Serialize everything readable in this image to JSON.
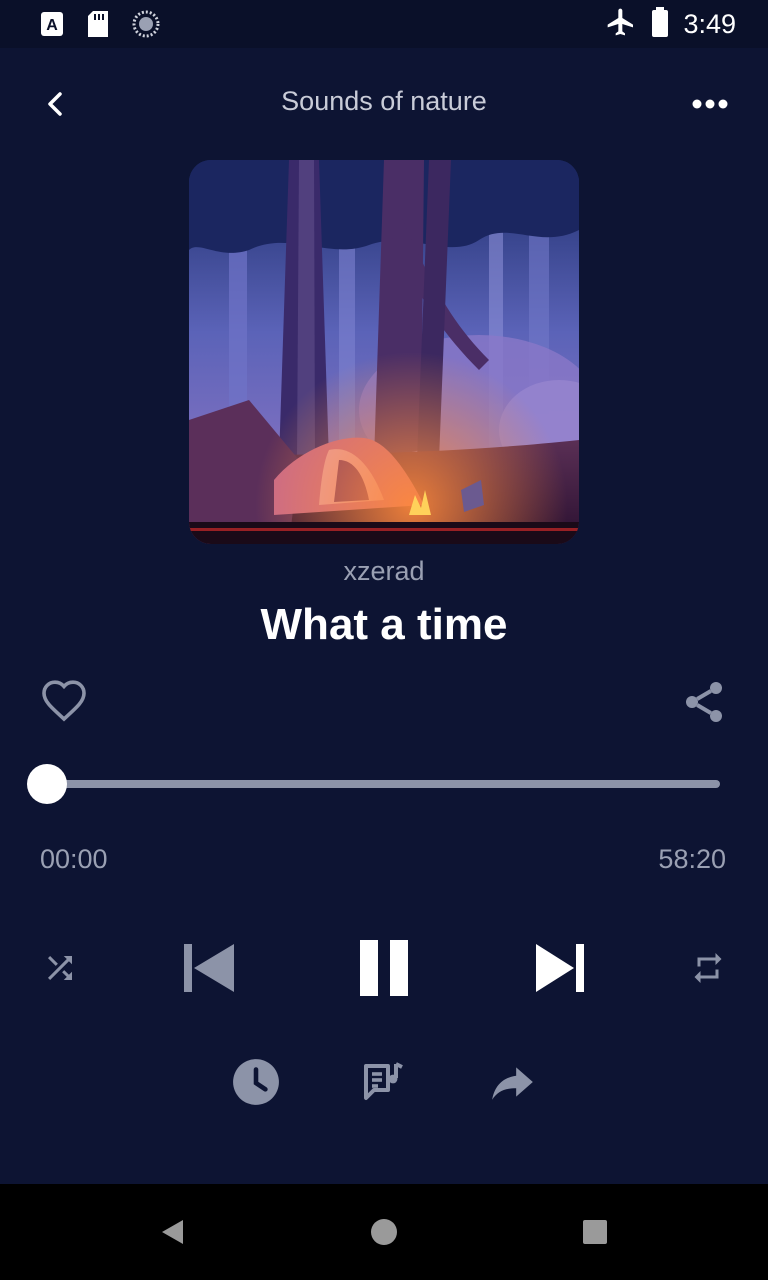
{
  "status_bar": {
    "time": "3:49",
    "icons": [
      "a-badge-icon",
      "sd-card-icon",
      "loading-spinner-icon",
      "airplane-icon",
      "battery-icon"
    ]
  },
  "header": {
    "title": "Sounds of nature",
    "back_icon": "chevron-left-icon",
    "menu_icon": "more-horizontal-icon"
  },
  "track": {
    "artist": "xzerad",
    "title": "What a time",
    "artwork": "camping-tent-forest-night-illustration"
  },
  "actions": {
    "favorite_icon": "heart-outline-icon",
    "share_icon": "share-icon"
  },
  "playback": {
    "elapsed": "00:00",
    "total": "58:20",
    "progress_fraction": 0.0
  },
  "controls": {
    "shuffle_icon": "shuffle-icon",
    "previous_icon": "skip-previous-icon",
    "play_pause_icon": "pause-icon",
    "next_icon": "skip-next-icon",
    "repeat_icon": "repeat-icon"
  },
  "secondary_controls": {
    "timer_icon": "clock-icon",
    "lyrics_icon": "lyrics-icon",
    "forward_icon": "share-forward-icon"
  },
  "nav_bar": {
    "back_icon": "nav-back-triangle-icon",
    "home_icon": "nav-home-circle-icon",
    "recents_icon": "nav-recents-square-icon"
  },
  "colors": {
    "background": "#0d1433",
    "muted_text": "#9aa0b3",
    "icon_muted": "#8c93a8"
  }
}
